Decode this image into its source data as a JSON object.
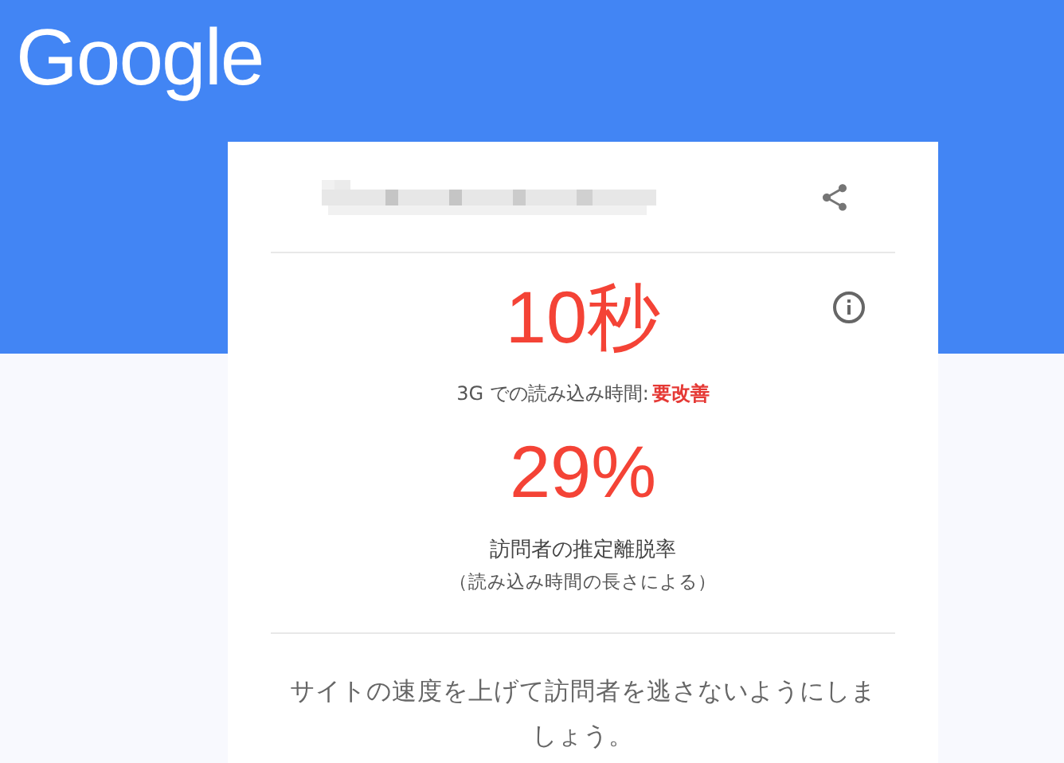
{
  "header": {
    "logo": "Google"
  },
  "card": {
    "load_time": "10秒",
    "load_time_label": "3G での読み込み時間:",
    "rating": "要改善",
    "bounce_rate": "29%",
    "bounce_label": "訪問者の推定離脱率",
    "bounce_note": "（読み込み時間の長さによる）",
    "advice": "サイトの速度を上げて訪問者を逃さないようにしましょう。"
  }
}
